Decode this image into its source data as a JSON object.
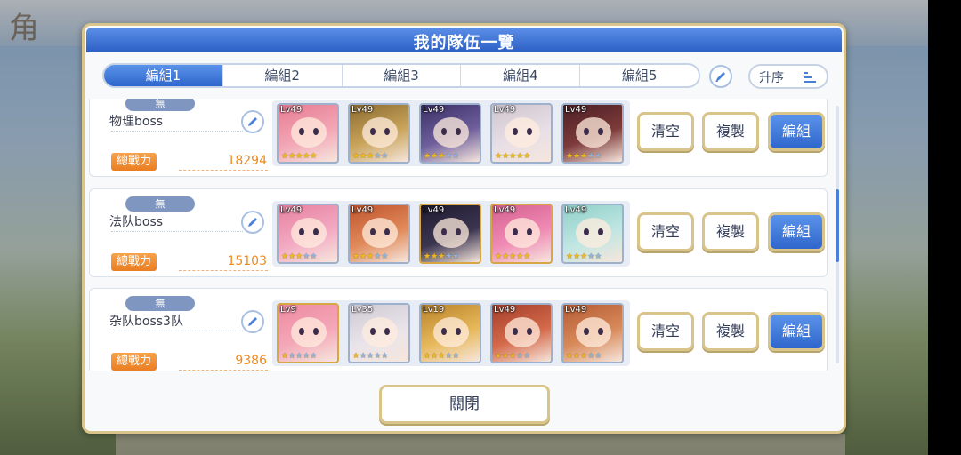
{
  "background": {
    "title_fragment": "角"
  },
  "dialog": {
    "title": "我的隊伍一覽",
    "tabs": [
      "編組1",
      "編組2",
      "編組3",
      "編組4",
      "編組5"
    ],
    "sort_label": "升序",
    "close_label": "關閉",
    "scroll_fraction": 0.45
  },
  "teams": [
    {
      "badge": "無",
      "name": "物理boss",
      "power_label": "總戰力",
      "power": "18294",
      "units": [
        {
          "lv": "Lv49",
          "stars": 5,
          "color": "#f2a6b5",
          "hair": "#e77b93",
          "border": "normal"
        },
        {
          "lv": "Lv49",
          "stars": 3,
          "color": "#c9a45b",
          "hair": "#8a6a2f",
          "border": "normal"
        },
        {
          "lv": "Lv49",
          "stars": 3,
          "color": "#6e5f9c",
          "hair": "#3b2f66",
          "border": "normal"
        },
        {
          "lv": "Lv49",
          "stars": 5,
          "color": "#e8dfe6",
          "hair": "#cfc4cc",
          "border": "normal"
        },
        {
          "lv": "Lv49",
          "stars": 3,
          "color": "#7d3a3a",
          "hair": "#4a1f25",
          "border": "normal"
        }
      ]
    },
    {
      "badge": "無",
      "name": "法队boss",
      "power_label": "總戰力",
      "power": "15103",
      "units": [
        {
          "lv": "Lv49",
          "stars": 3,
          "color": "#f3a9c2",
          "hair": "#e6819f",
          "border": "normal"
        },
        {
          "lv": "Lv49",
          "stars": 3,
          "color": "#e08a5a",
          "hair": "#c0532d",
          "border": "normal"
        },
        {
          "lv": "Lv49",
          "stars": 3,
          "color": "#3b3550",
          "hair": "#1f1a30",
          "border": "gold"
        },
        {
          "lv": "Lv49",
          "stars": 5,
          "color": "#f08ab4",
          "hair": "#d4608f",
          "border": "gold"
        },
        {
          "lv": "Lv49",
          "stars": 3,
          "color": "#bfe6e2",
          "hair": "#8fcfc8",
          "border": "normal"
        }
      ]
    },
    {
      "badge": "無",
      "name": "杂队boss3队",
      "power_label": "總戰力",
      "power": "9386",
      "units": [
        {
          "lv": "Lv9",
          "stars": 1,
          "color": "#f4a7b8",
          "hair": "#ee8aa2",
          "border": "gold"
        },
        {
          "lv": "Lv35",
          "stars": 1,
          "color": "#e9e4ea",
          "hair": "#cfc9d3",
          "border": "normal"
        },
        {
          "lv": "Lv19",
          "stars": 3,
          "color": "#e7b85a",
          "hair": "#b9822a",
          "border": "normal"
        },
        {
          "lv": "Lv49",
          "stars": 3,
          "color": "#d46a4a",
          "hair": "#a23e2a",
          "border": "normal"
        },
        {
          "lv": "Lv49",
          "stars": 3,
          "color": "#d88a5a",
          "hair": "#b45a33",
          "border": "normal"
        }
      ]
    }
  ],
  "buttons": {
    "clear": "清空",
    "copy": "複製",
    "edit": "編組"
  }
}
